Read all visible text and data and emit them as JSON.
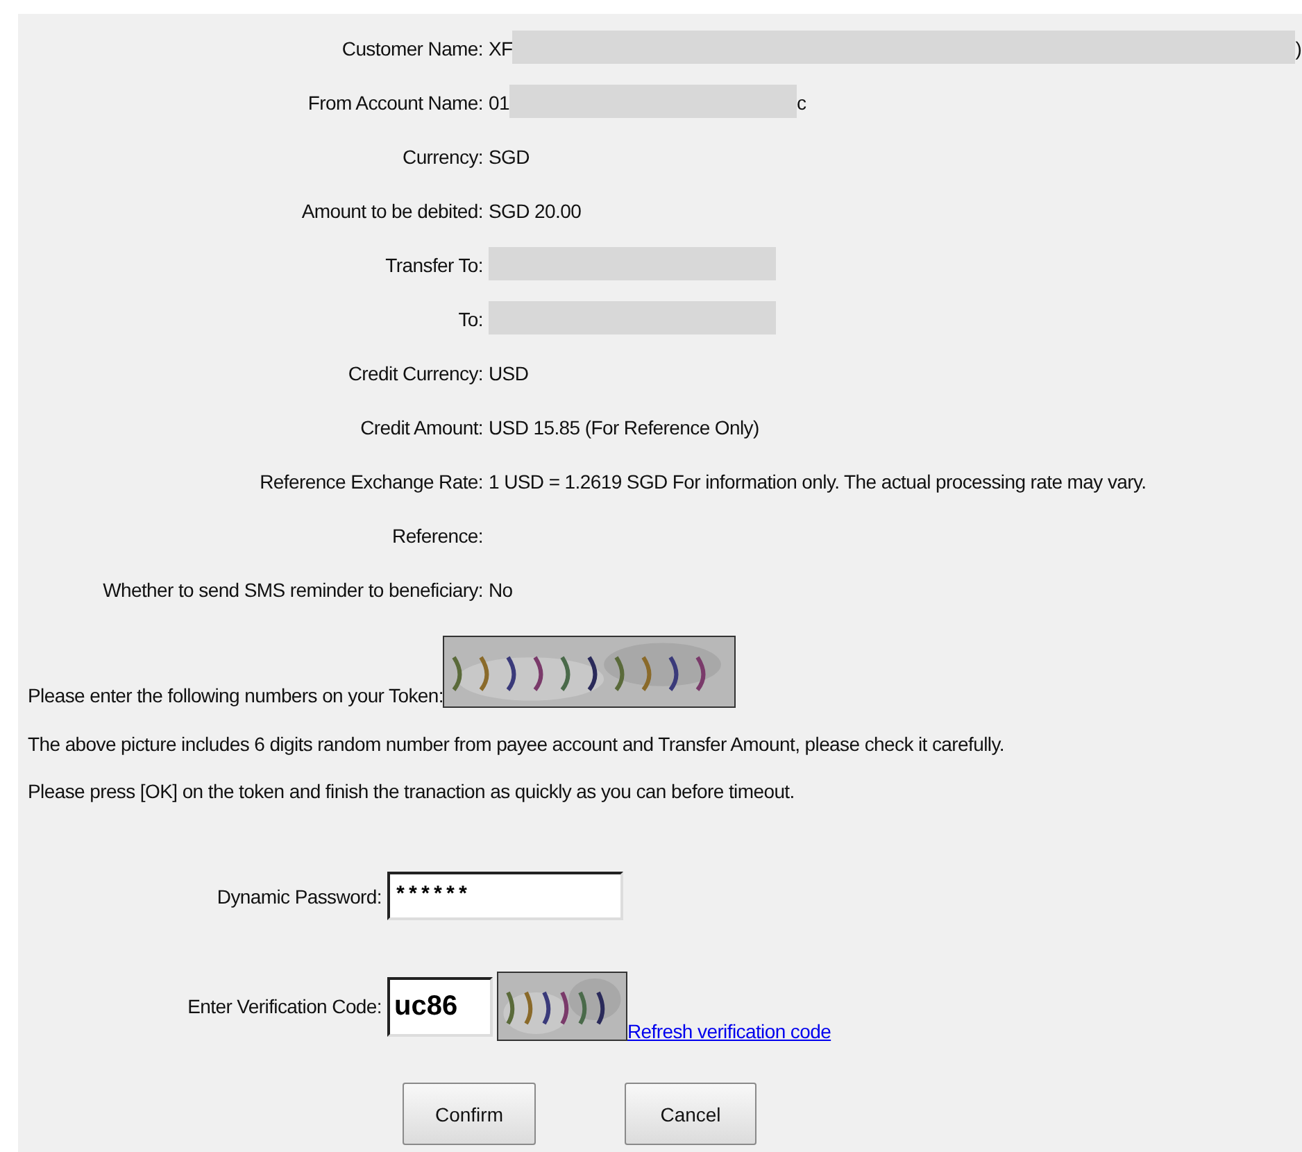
{
  "details": [
    {
      "label": "Customer Name:",
      "value": "XF",
      "kind": "wide",
      "value_after": ")"
    },
    {
      "label": "From Account Name:",
      "value": "01",
      "kind": "narrow",
      "value_after": "c"
    },
    {
      "label": "Currency:",
      "value": "SGD",
      "kind": "plain"
    },
    {
      "label": "Amount to be debited:",
      "value": "SGD 20.00",
      "kind": "plain"
    },
    {
      "label": "Transfer To:",
      "kind": "narrow"
    },
    {
      "label": "To:",
      "kind": "narrow"
    },
    {
      "label": "Credit Currency:",
      "value": "USD",
      "kind": "plain"
    },
    {
      "label": "Credit Amount:",
      "value": "USD 15.85 (For Reference Only)",
      "kind": "plain"
    },
    {
      "label": "Reference Exchange Rate:",
      "value": "1 USD = 1.2619 SGD For information only. The actual processing rate may vary.",
      "kind": "plain"
    },
    {
      "label": "Reference:",
      "kind": "plain"
    },
    {
      "label": "Whether to send SMS reminder to beneficiary:",
      "value": "No",
      "kind": "plain"
    }
  ],
  "token": {
    "label": "Please enter the following numbers on your Token:"
  },
  "notes": [
    "The above picture includes 6 digits random number from payee account and Transfer Amount, please check it carefully.",
    "Please press [OK] on the token and finish the tranaction as quickly as you can before timeout."
  ],
  "password": {
    "label": "Dynamic Password:",
    "value": "******"
  },
  "verification": {
    "label": "Enter Verification Code:",
    "value": "uc86",
    "refresh_link": "Refresh verification code"
  },
  "buttons": [
    "Confirm",
    "Cancel"
  ]
}
